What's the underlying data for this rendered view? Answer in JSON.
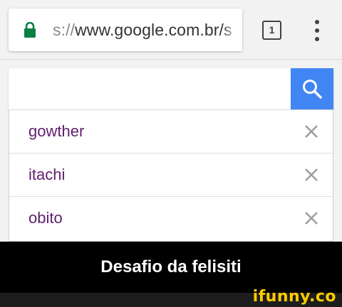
{
  "browser": {
    "url_scheme": "s://",
    "url_host": "www.google.com.br/s",
    "tab_count": "1",
    "lock_icon": "lock-icon",
    "menu_icon": "more-vert-icon"
  },
  "search": {
    "query": "",
    "button_icon": "search-icon",
    "button_color": "#4285f4"
  },
  "suggestions": [
    {
      "label": "gowther"
    },
    {
      "label": "itachi"
    },
    {
      "label": "obito"
    }
  ],
  "colors": {
    "suggestion_text": "#61206f",
    "lock_green": "#0b8043"
  },
  "caption": {
    "text": "Desafio da felisiti"
  },
  "watermark": {
    "text": "ifunny.co"
  }
}
